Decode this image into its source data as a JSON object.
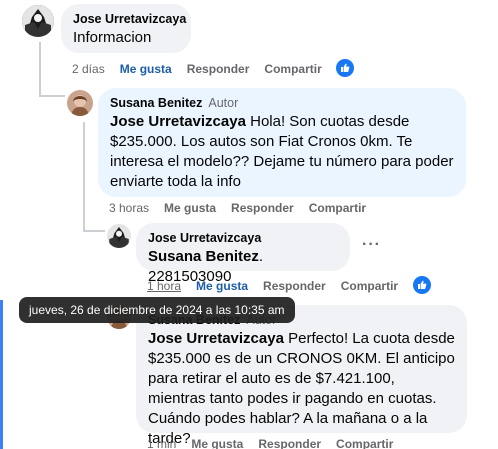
{
  "comments": [
    {
      "author": "Jose Urretavizcaya",
      "text": "Informacion",
      "time": "2 días",
      "like": "Me gusta",
      "reply": "Responder",
      "share": "Compartir"
    },
    {
      "author": "Susana Benitez",
      "badge": "Autor",
      "mention": "Jose Urretavizcaya",
      "text": " Hola! Son cuotas desde $235.000. Los autos son Fiat Cronos 0km. Te interesa el modelo?? Dejame tu número para poder enviarte toda la info",
      "time": "3 horas",
      "like": "Me gusta",
      "reply": "Responder",
      "share": "Compartir"
    },
    {
      "author": "Jose Urretavizcaya",
      "mention": "Susana Benitez",
      "text": ". 2281503090",
      "time": "1 hora",
      "like": "Me gusta",
      "reply": "Responder",
      "share": "Compartir"
    },
    {
      "author": "Susana Benitez",
      "badge": "Autor",
      "mention": "Jose Urretavizcaya",
      "text": " Perfecto! La cuota desde $235.000 es de un CRONOS 0KM. El anticipo para retirar el auto es de $7.421.100, mientras tanto podes ir pagando en cuotas. Cuándo podes hablar? A la mañana o a la tarde?",
      "time": "1 min",
      "like": "Me gusta",
      "reply": "Responder",
      "share": "Compartir"
    }
  ],
  "tooltip": "jueves, 26 de diciembre de 2024 a las 10:35 am",
  "more_menu": "···",
  "colors": {
    "accent": "#1877f2",
    "liked": "#1d5ea8",
    "bubble_grey": "#f0f2f5",
    "bubble_blue": "#ebf5ff"
  }
}
